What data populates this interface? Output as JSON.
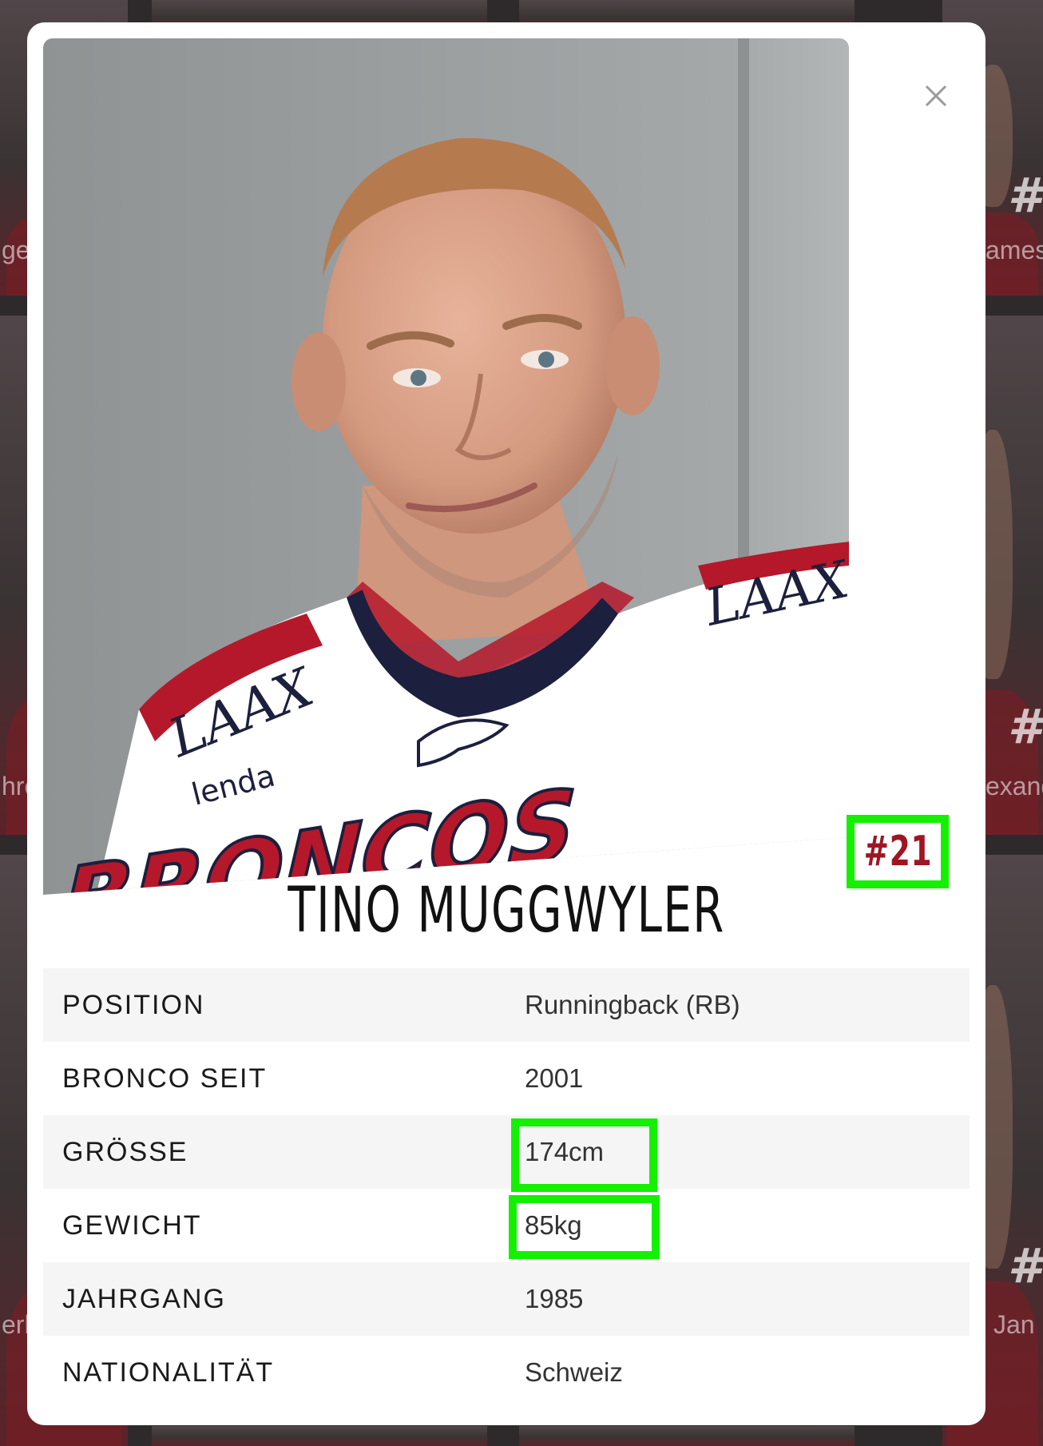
{
  "background_roster": {
    "numbers": [
      "#",
      "#",
      "#"
    ],
    "name_fragments": [
      "ger",
      "ames",
      "hre",
      "exand",
      "erh",
      "Jan"
    ]
  },
  "modal": {
    "close_icon": "close-icon",
    "photo_alt": "Player photo",
    "jersey_text": "BRONCOS",
    "sponsor_text": "LAAX",
    "sponsor_text_2": "lenda",
    "player_number": "#21",
    "player_name": "TINO MUGGWYLER",
    "details": [
      {
        "label": "POSITION",
        "value": "Runningback (RB)"
      },
      {
        "label": "BRONCO SEIT",
        "value": "2001"
      },
      {
        "label": "GRÖSSE",
        "value": "174cm"
      },
      {
        "label": "GEWICHT",
        "value": "85kg"
      },
      {
        "label": "JAHRGANG",
        "value": "1985"
      },
      {
        "label": "NATIONALITÄT",
        "value": "Schweiz"
      }
    ]
  },
  "colors": {
    "highlight": "#13f000",
    "number": "#9e1622",
    "jersey_red": "#b5182a",
    "jersey_navy": "#1c1f3d"
  }
}
